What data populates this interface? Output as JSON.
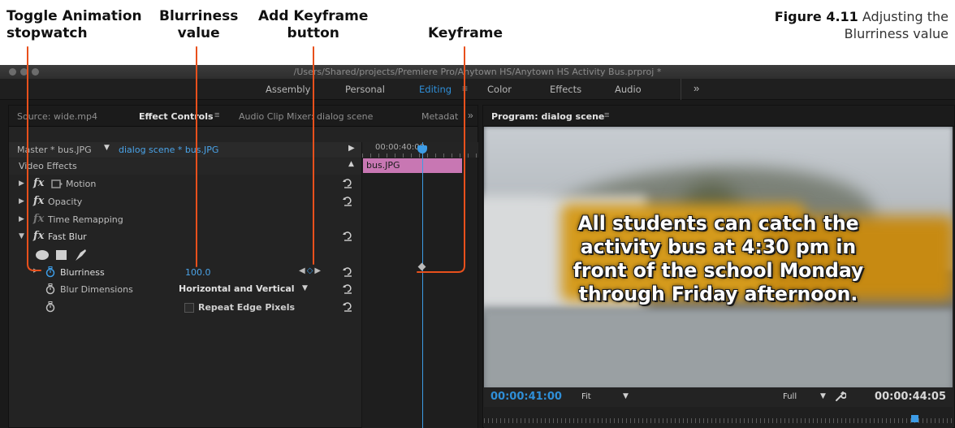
{
  "callouts": {
    "toggle": {
      "line1": "Toggle Animation",
      "line2": "stopwatch"
    },
    "blurriness": {
      "line1": "Blurriness",
      "line2": "value"
    },
    "add_keyframe": {
      "line1": "Add Keyframe",
      "line2": "button"
    },
    "keyframe": {
      "line1": "Keyframe"
    }
  },
  "figure_caption": {
    "label": "Figure 4.11",
    "text": "Adjusting the Blurriness value"
  },
  "window": {
    "title": "/Users/Shared/projects/Premiere Pro/Anytown HS/Anytown HS Activity Bus.prproj *"
  },
  "workspaces": {
    "tabs": [
      {
        "label": "Assembly"
      },
      {
        "label": "Personal"
      },
      {
        "label": "Editing",
        "active": true
      },
      {
        "label": "Color"
      },
      {
        "label": "Effects"
      },
      {
        "label": "Audio"
      }
    ],
    "more": "»"
  },
  "left_panel": {
    "tabs": [
      {
        "label": "Source: wide.mp4"
      },
      {
        "label": "Effect Controls",
        "active": true
      },
      {
        "label": "Audio Clip Mixer: dialog scene"
      },
      {
        "label": "Metadat"
      }
    ],
    "more": "»",
    "master_label": "Master * bus.JPG",
    "sequence_clip": "dialog scene * bus.JPG",
    "section": "Video Effects",
    "effects": [
      {
        "label": "Motion"
      },
      {
        "label": "Opacity"
      },
      {
        "label": "Time Remapping"
      },
      {
        "label": "Fast Blur"
      }
    ],
    "properties": {
      "blurriness": {
        "label": "Blurriness",
        "value": "100.0"
      },
      "blur_dimensions": {
        "label": "Blur Dimensions",
        "value": "Horizontal and Vertical"
      },
      "repeat_edge": {
        "label": "Repeat Edge Pixels"
      }
    },
    "timeline": {
      "timecode": "00:00:40:00",
      "clip_name": "bus.JPG"
    }
  },
  "right_panel": {
    "tab": "Program: dialog scene",
    "caption_lines": [
      "All students can catch the",
      "activity bus at 4:30 pm in",
      "front of the school Monday",
      "through Friday afternoon."
    ],
    "current_time": "00:00:41:00",
    "fit": "Fit",
    "resolution": "Full",
    "duration": "00:00:44:05"
  },
  "colors": {
    "accent_blue": "#2f8fd8",
    "clip_pink": "#c877b3",
    "callout_red": "#e8501c"
  }
}
